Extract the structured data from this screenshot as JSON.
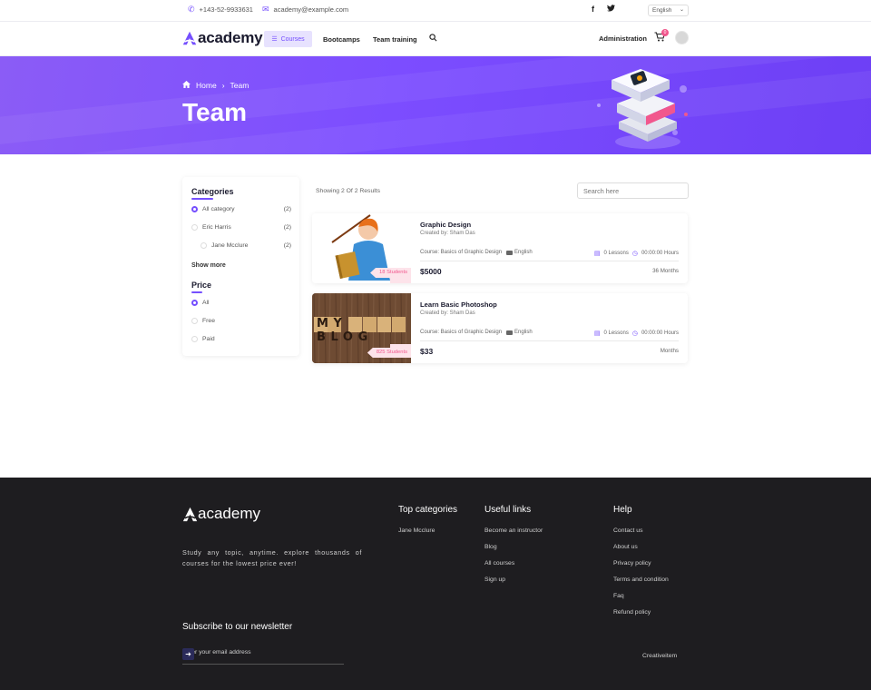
{
  "topbar": {
    "phone": "+143-52-9933631",
    "email": "academy@example.com",
    "language": "English",
    "social": [
      "f",
      "t"
    ]
  },
  "nav": {
    "brand": "academy",
    "courses": "Courses",
    "bootcamps": "Bootcamps",
    "team_training": "Team training",
    "administration": "Administration",
    "cart_count": "0"
  },
  "hero": {
    "breadcrumb_home": "Home",
    "breadcrumb_current": "Team",
    "title": "Team"
  },
  "sidebar": {
    "categories_title": "Categories",
    "categories": [
      {
        "label": "All category",
        "count": "(2)",
        "selected": true
      },
      {
        "label": "Eric Harris",
        "count": "(2)",
        "selected": false
      },
      {
        "label": "Jane Mcclure",
        "count": "(2)",
        "selected": false
      }
    ],
    "show_more": "Show more",
    "price_title": "Price",
    "prices": [
      {
        "label": "All",
        "selected": true
      },
      {
        "label": "Free",
        "selected": false
      },
      {
        "label": "Paid",
        "selected": false
      }
    ]
  },
  "results": {
    "showing": "Showing 2 Of 2 Results",
    "search_placeholder": "Search here"
  },
  "courses": [
    {
      "title": "Graphic Design",
      "created_by": "Created by: Sham Das",
      "course": "Course: Basics of Graphic Design",
      "language": "English",
      "lessons": "0 Lessons",
      "hours": "00:00:00 Hours",
      "price": "$5000",
      "duration": "36 Months",
      "students": "18 Students"
    },
    {
      "title": "Learn Basic Photoshop",
      "created_by": "Created by: Sham Das",
      "course": "Course: Basics of Graphic Design",
      "language": "English",
      "lessons": "0 Lessons",
      "hours": "00:00:00 Hours",
      "price": "$33",
      "duration": "Months",
      "students": "825 Students",
      "thumb_text": "MY BLOG"
    }
  ],
  "footer": {
    "brand": "academy",
    "tagline": "Study any topic, anytime. explore thousands of courses for the lowest price ever!",
    "top_categories_title": "Top categories",
    "top_categories": [
      "Jane Mcclure"
    ],
    "useful_links_title": "Useful links",
    "useful_links": [
      "Become an instructor",
      "Blog",
      "All courses",
      "Sign up"
    ],
    "help_title": "Help",
    "help_links": [
      "Contact us",
      "About us",
      "Privacy policy",
      "Terms and condition",
      "Faq",
      "Refund policy"
    ],
    "newsletter_title": "Subscribe to our newsletter",
    "email_placeholder": "Enter your email address",
    "credit": "Creativeitem"
  },
  "colors": {
    "accent": "#754ffe",
    "footer_bg": "#1e1d20",
    "badge": "#f1578d"
  }
}
